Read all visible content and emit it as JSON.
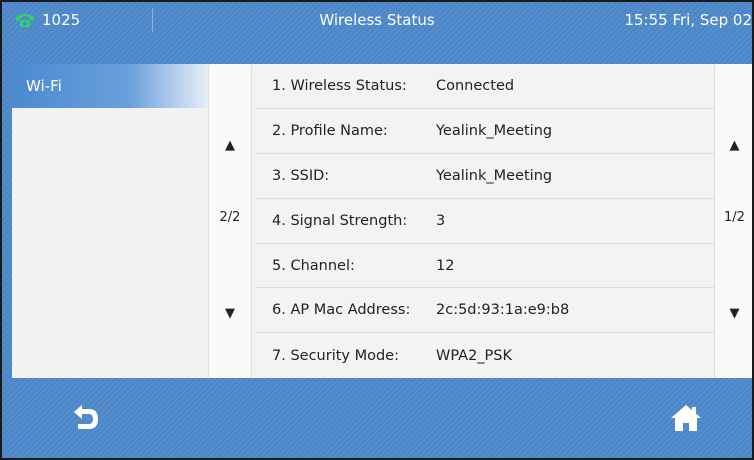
{
  "titlebar": {
    "line_number": "1025",
    "title": "Wireless Status",
    "datetime": "15:55 Fri, Sep 02"
  },
  "sidebar": {
    "items": [
      {
        "label": "Wi-Fi"
      }
    ]
  },
  "left_scroll": {
    "up": "▲",
    "page": "2/2",
    "down": "▼"
  },
  "right_scroll": {
    "up": "▲",
    "page": "1/2",
    "down": "▼"
  },
  "status_rows": [
    {
      "label": "1. Wireless Status:",
      "value": "Connected"
    },
    {
      "label": "2. Profile Name:",
      "value": "Yealink_Meeting"
    },
    {
      "label": "3. SSID:",
      "value": "Yealink_Meeting"
    },
    {
      "label": "4. Signal Strength:",
      "value": "3"
    },
    {
      "label": "5. Channel:",
      "value": "12"
    },
    {
      "label": "6. AP Mac Address:",
      "value": "2c:5d:93:1a:e9:b8"
    },
    {
      "label": "7. Security Mode:",
      "value": "WPA2_PSK"
    }
  ],
  "icons": {
    "phone": "phone-icon",
    "back": "back-icon",
    "home": "home-icon"
  },
  "colors": {
    "accent": "#4c87c8",
    "phone_icon": "#2fd16b",
    "content_bg": "#f2f2f2"
  }
}
